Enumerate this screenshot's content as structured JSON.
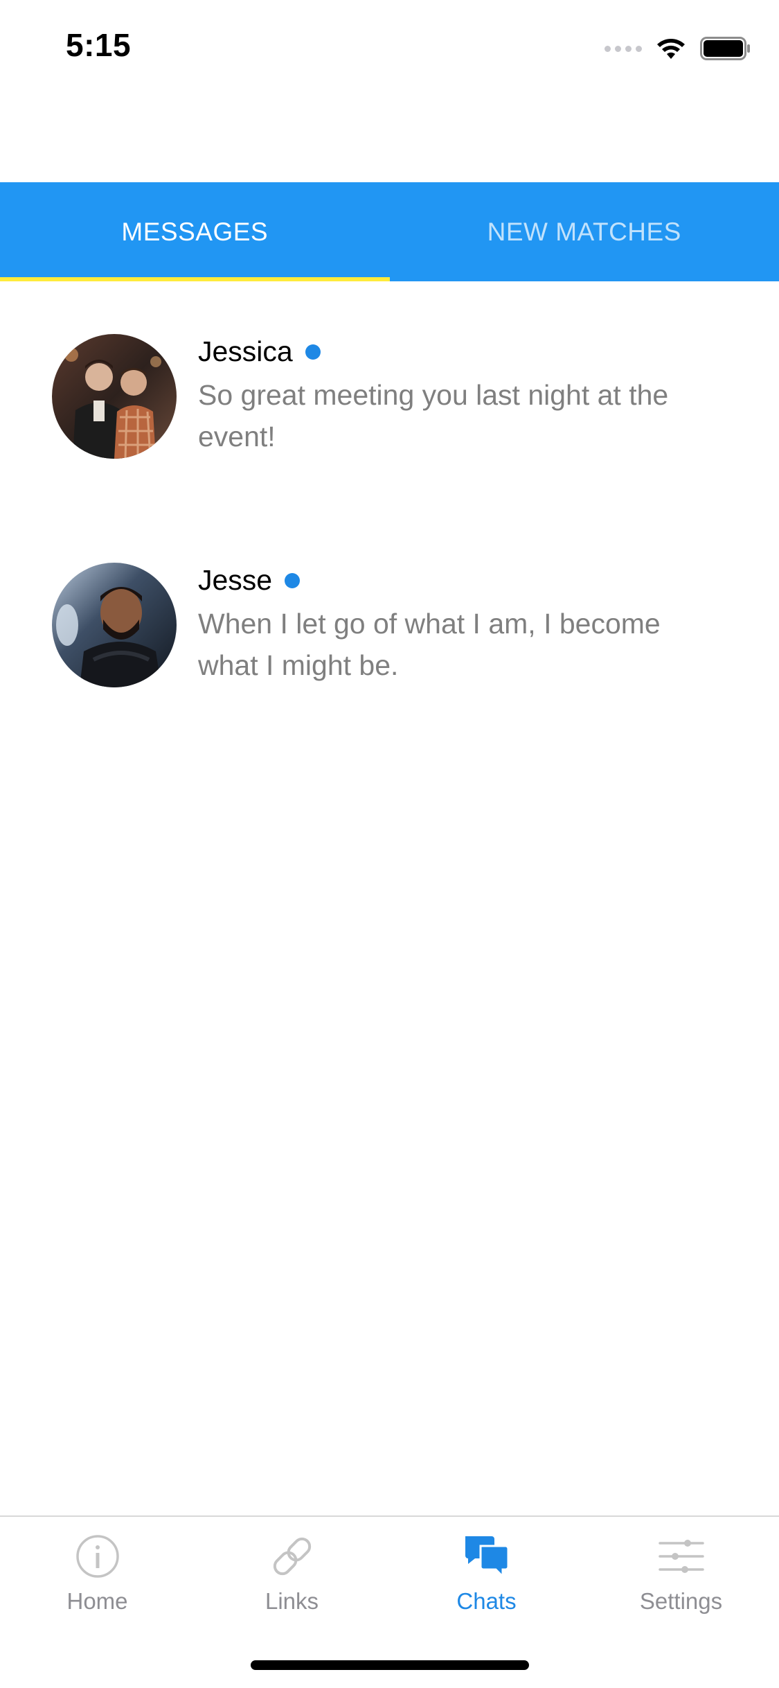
{
  "status_bar": {
    "time": "5:15"
  },
  "tabs": [
    {
      "label": "MESSAGES",
      "active": true
    },
    {
      "label": "NEW MATCHES",
      "active": false
    }
  ],
  "colors": {
    "header_blue": "#2196F3",
    "tab_indicator": "#ffeb3b",
    "online_dot": "#1e88e5",
    "active_tab": "#1e88e5"
  },
  "messages": [
    {
      "name": "Jessica",
      "online": true,
      "preview": "So great meeting you last night at the event!"
    },
    {
      "name": "Jesse",
      "online": true,
      "preview": "When I let go of what I am, I become what I might be."
    }
  ],
  "bottom_nav": [
    {
      "label": "Home",
      "icon": "info-circle-icon",
      "active": false
    },
    {
      "label": "Links",
      "icon": "link-icon",
      "active": false
    },
    {
      "label": "Chats",
      "icon": "chat-bubbles-icon",
      "active": true
    },
    {
      "label": "Settings",
      "icon": "sliders-icon",
      "active": false
    }
  ]
}
